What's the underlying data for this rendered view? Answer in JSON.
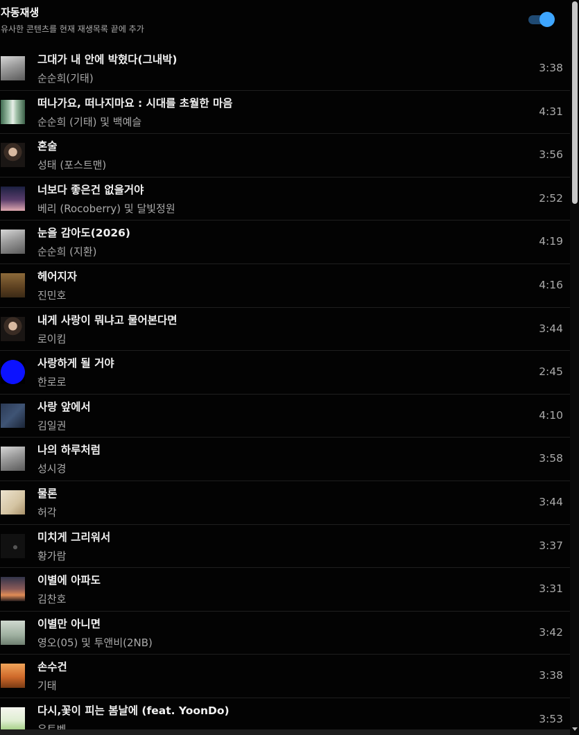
{
  "autoplay": {
    "title": "자동재생",
    "subtitle": "유사한 콘텐츠를 현재 재생목록 끝에 추가",
    "enabled": true,
    "toggle_color": "#3ea6ff"
  },
  "tracks": [
    {
      "title": "그대가 내 안에 박혔다(그내박)",
      "artist": "순순희(기태)",
      "duration": "3:38",
      "thumb": "grayscale-photo"
    },
    {
      "title": "떠나가요, 떠나지마요 : 시대를 초월한 마음",
      "artist": "순순희 (기태) 및 백예슬",
      "duration": "4:31",
      "thumb": "green-trees-photo"
    },
    {
      "title": "혼술",
      "artist": "성태 (포스트맨)",
      "duration": "3:56",
      "thumb": "portrait-photo"
    },
    {
      "title": "너보다 좋은건 없을거야",
      "artist": "베리 (Rocoberry) 및 달빛정원",
      "duration": "2:52",
      "thumb": "night-sky-photo"
    },
    {
      "title": "눈을 감아도(2026)",
      "artist": "순순희 (지환)",
      "duration": "4:19",
      "thumb": "grayscale-photo"
    },
    {
      "title": "헤어지자",
      "artist": "진민호",
      "duration": "4:16",
      "thumb": "brown-cover"
    },
    {
      "title": "내게 사랑이 뭐냐고 물어본다면",
      "artist": "로이킴",
      "duration": "3:44",
      "thumb": "portrait-photo"
    },
    {
      "title": "사랑하게 될 거야",
      "artist": "한로로",
      "duration": "2:45",
      "thumb": "blue-circle-cover"
    },
    {
      "title": "사랑 앞에서",
      "artist": "김일권",
      "duration": "4:10",
      "thumb": "dark-blue-cover"
    },
    {
      "title": "나의 하루처럼",
      "artist": "성시경",
      "duration": "3:58",
      "thumb": "grayscale-photo"
    },
    {
      "title": "물론",
      "artist": "허각",
      "duration": "3:44",
      "thumb": "beige-cover"
    },
    {
      "title": "미치게 그리워서",
      "artist": "황가람",
      "duration": "3:37",
      "thumb": "black-calligraphy-cover"
    },
    {
      "title": "이별에 아파도",
      "artist": "김찬호",
      "duration": "3:31",
      "thumb": "sunset-photo"
    },
    {
      "title": "이별만 아니면",
      "artist": "영오(05) 및 투앤비(2NB)",
      "duration": "3:42",
      "thumb": "pale-green-cover"
    },
    {
      "title": "손수건",
      "artist": "기태",
      "duration": "3:38",
      "thumb": "orange-cover"
    },
    {
      "title": "다시,꽃이 피는 봄날에 (feat. YoonDo)",
      "artist": "유토벤",
      "duration": "3:53",
      "thumb": "spring-flowers-photo"
    }
  ]
}
